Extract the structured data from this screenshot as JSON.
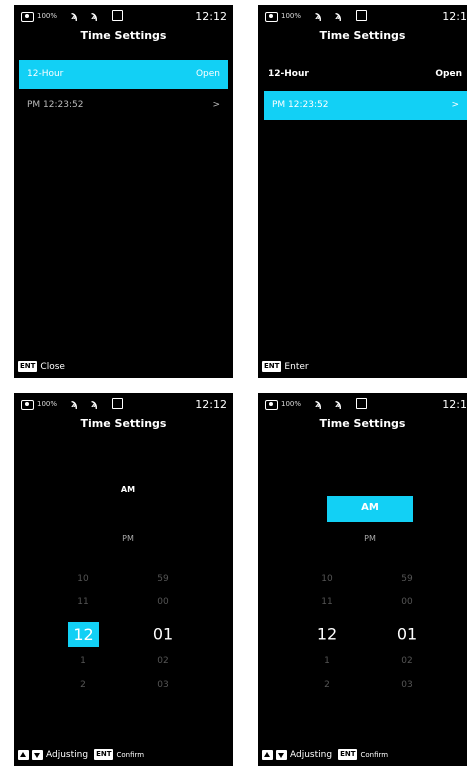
{
  "status": {
    "battery": "100%",
    "time": "12:12",
    "time_clipped": "12:1"
  },
  "title": "Time Settings",
  "row_format": {
    "label": "12-Hour",
    "value": "Open"
  },
  "row_time": {
    "label": "PM 12:23:52",
    "chevron": ">"
  },
  "footer1": {
    "key": "ENT",
    "text": "Close"
  },
  "footer2": {
    "key": "ENT",
    "text": "Enter"
  },
  "footer_adjust": {
    "text": "Adjusting",
    "key": "ENT",
    "confirm": "Confirm"
  },
  "picker": {
    "am": "AM",
    "pm": "PM",
    "hours": [
      "10",
      "11",
      "12",
      "1",
      "2"
    ],
    "minutes": [
      "59",
      "00",
      "01",
      "02",
      "03"
    ]
  },
  "colors": {
    "accent": "#12d0f5",
    "background": "#000000"
  }
}
